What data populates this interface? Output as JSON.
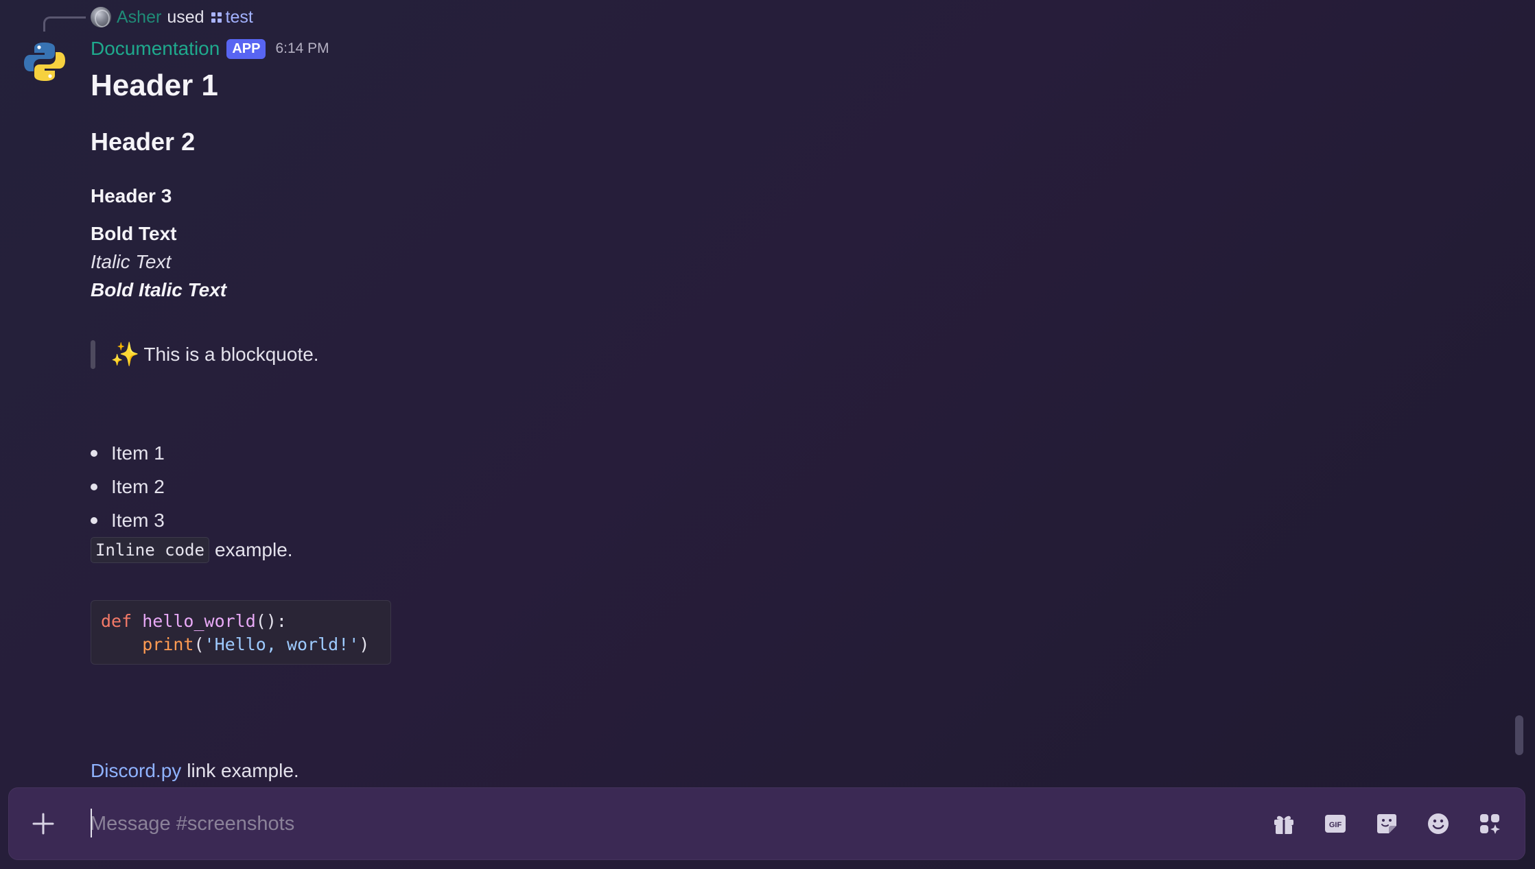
{
  "reply": {
    "user": "Asher",
    "used": "used",
    "command": "test"
  },
  "message": {
    "author": "Documentation",
    "badge": "APP",
    "time": "6:14 PM",
    "h1": "Header 1",
    "h2": "Header 2",
    "h3": "Header 3",
    "bold": "Bold Text",
    "italic": "Italic Text",
    "bold_italic": "Bold Italic Text",
    "blockquote_emoji": "✨",
    "blockquote": "This is a blockquote.",
    "list": [
      "Item 1",
      "Item 2",
      "Item 3"
    ],
    "inline_code": "Inline code",
    "inline_suffix": "example.",
    "code_block": {
      "line1_kw": "def",
      "line1_fn": "hello_world",
      "line1_rest": "():",
      "line2_indent": "    ",
      "line2_fn": "print",
      "line2_open": "(",
      "line2_str": "'Hello, world!'",
      "line2_close": ")"
    },
    "link_text": "Discord.py",
    "link_suffix": "link example."
  },
  "composer": {
    "placeholder": "Message #screenshots",
    "add_icon": "plus-icon",
    "icons": [
      "gift-icon",
      "gif-icon",
      "sticker-icon",
      "emoji-icon",
      "apps-icon"
    ]
  },
  "colors": {
    "background": "#25203a",
    "author": "#1fa98d",
    "badge": "#5865f2",
    "link": "#8fb3ff",
    "composer": "#3b2954"
  }
}
